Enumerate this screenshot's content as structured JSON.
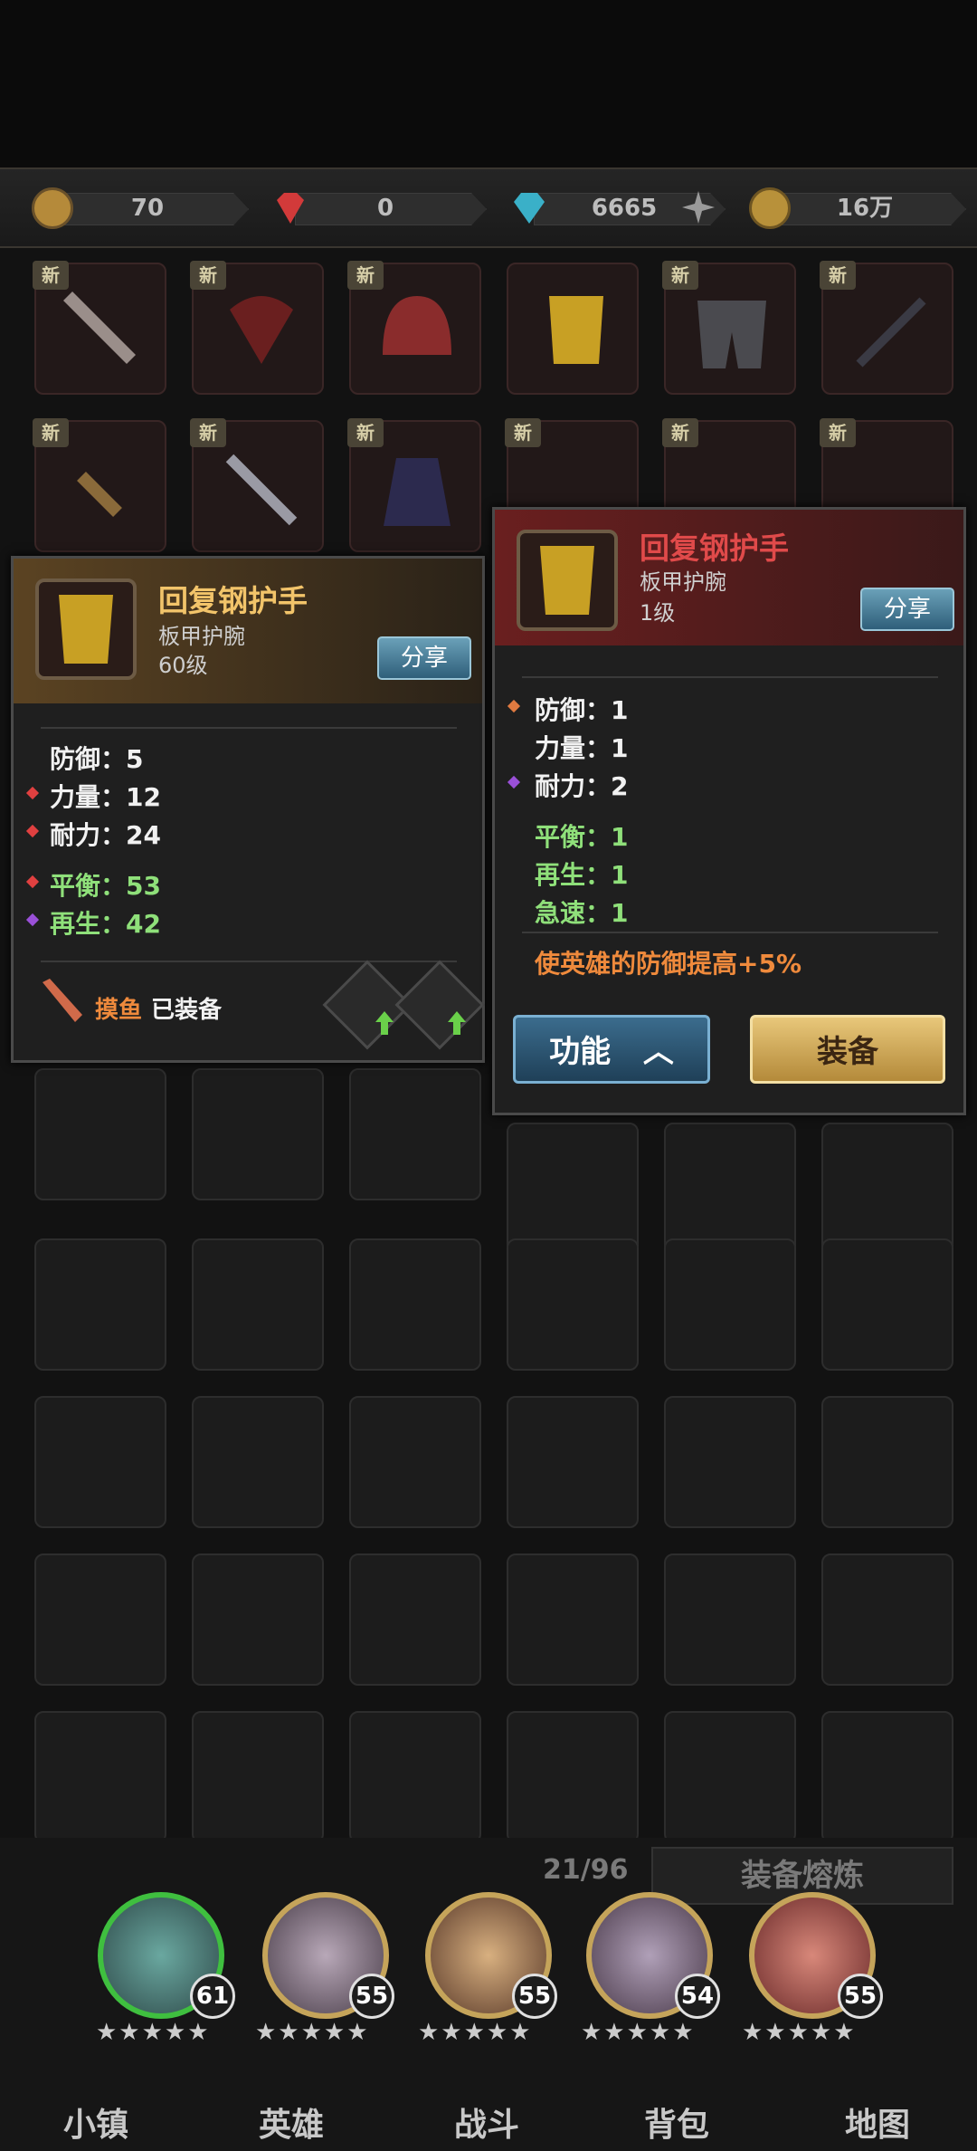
{
  "resources": [
    {
      "name": "stamina",
      "value": "70",
      "icon": "stamina-icon",
      "color": "#b58a3a"
    },
    {
      "name": "ruby",
      "value": "0",
      "icon": "ruby-icon",
      "color": "#d23a3a"
    },
    {
      "name": "diamond",
      "value": "6665",
      "icon": "diamond-icon",
      "color": "#3ab0c8"
    },
    {
      "name": "gold",
      "value": "16万",
      "icon": "gold-coin-icon",
      "color": "#b8913a"
    }
  ],
  "inventory": {
    "new_tag": "新",
    "count": "21/96",
    "smelt_label": "装备熔炼"
  },
  "equipped_panel": {
    "title": "回复钢护手",
    "type": "板甲护腕",
    "level": "60级",
    "share": "分享",
    "stats": [
      {
        "label": "防御：5",
        "color": "white"
      },
      {
        "label": "力量：12",
        "color": "white"
      },
      {
        "label": "耐力：24",
        "color": "white"
      }
    ],
    "bonus": [
      {
        "label": "平衡：53"
      },
      {
        "label": "再生：42"
      }
    ],
    "equipped_by_name": "摸鱼",
    "equipped_status": "已装备"
  },
  "new_panel": {
    "title": "回复钢护手",
    "type": "板甲护腕",
    "level": "1级",
    "share": "分享",
    "stats": [
      {
        "label": "防御：1"
      },
      {
        "label": "力量：1"
      },
      {
        "label": "耐力：2"
      }
    ],
    "bonus": [
      {
        "label": "平衡：1"
      },
      {
        "label": "再生：1"
      },
      {
        "label": "急速：1"
      }
    ],
    "effect": "使英雄的防御提高+5%",
    "function_btn": "功能",
    "equip_btn": "装备"
  },
  "heroes": [
    {
      "level": "61"
    },
    {
      "level": "55"
    },
    {
      "level": "55"
    },
    {
      "level": "54"
    },
    {
      "level": "55"
    }
  ],
  "nav": [
    "小镇",
    "英雄",
    "战斗",
    "背包",
    "地图"
  ]
}
